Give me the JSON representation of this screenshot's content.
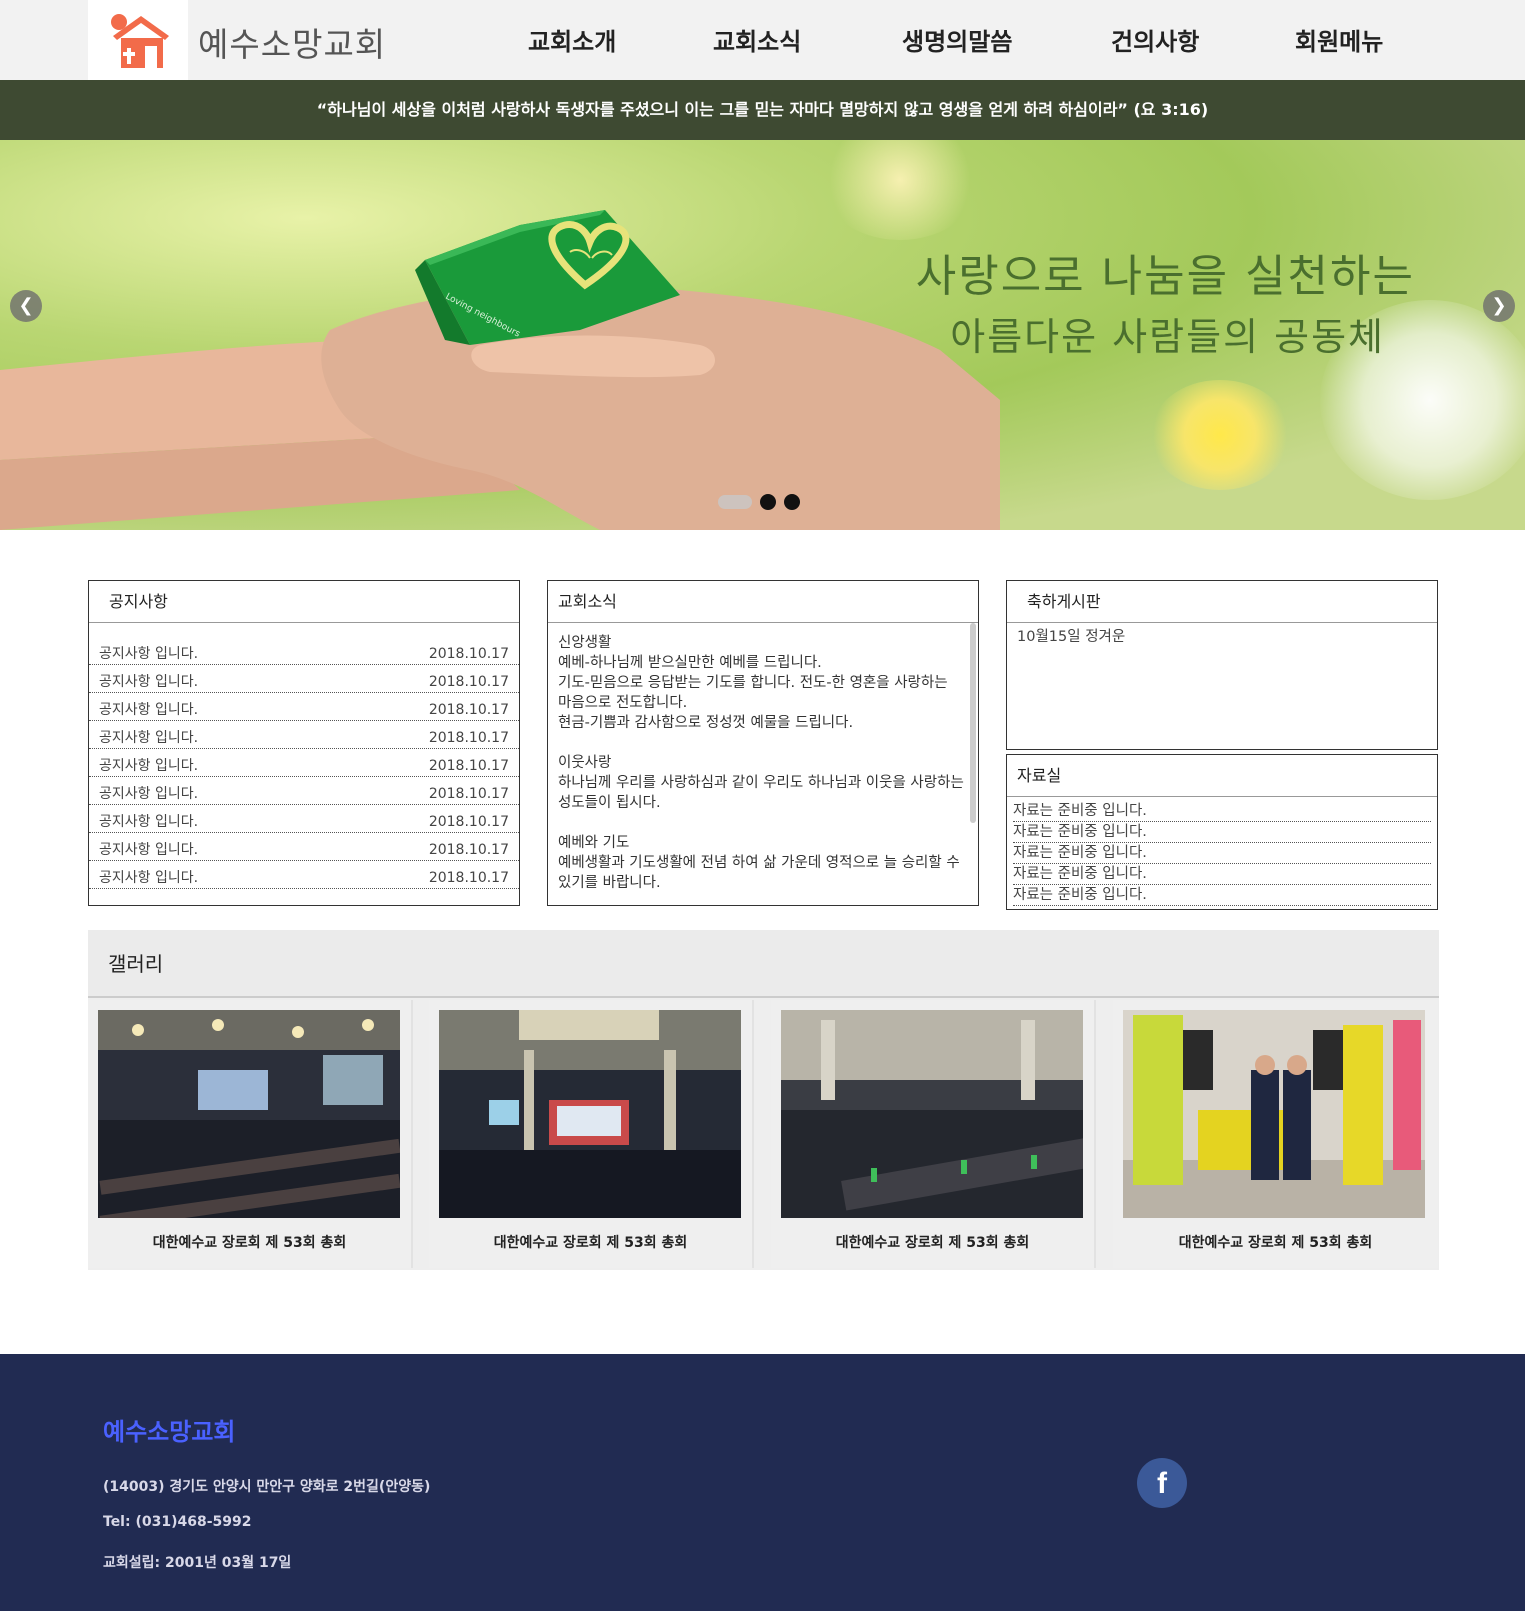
{
  "header": {
    "site_title": "예수소망교회",
    "nav": [
      "교회소개",
      "교회소식",
      "생명의말씀",
      "건의사항",
      "회원메뉴"
    ]
  },
  "verse": "“하나님이 세상을 이처럼 사랑하사 독생자를 주셨으니 이는 그를 믿는 자마다 멸망하지 않고 영생을 얻게 하려 하심이라” (요 3:16)",
  "slider": {
    "line1": "사랑으로 나눔을 실천하는",
    "line2": "아름다운 사람들의 공동체",
    "box_text": "Loving neighbours",
    "prev": "❮",
    "next": "❯",
    "slide_count": 3,
    "active_index": 0
  },
  "notice": {
    "title": "공지사항",
    "rows": [
      {
        "text": "공지사항 입니다.",
        "date": "2018.10.17"
      },
      {
        "text": "공지사항 입니다.",
        "date": "2018.10.17"
      },
      {
        "text": "공지사항 입니다.",
        "date": "2018.10.17"
      },
      {
        "text": "공지사항 입니다.",
        "date": "2018.10.17"
      },
      {
        "text": "공지사항 입니다.",
        "date": "2018.10.17"
      },
      {
        "text": "공지사항 입니다.",
        "date": "2018.10.17"
      },
      {
        "text": "공지사항 입니다.",
        "date": "2018.10.17"
      },
      {
        "text": "공지사항 입니다.",
        "date": "2018.10.17"
      },
      {
        "text": "공지사항 입니다.",
        "date": "2018.10.17"
      }
    ]
  },
  "news": {
    "title": "교회소식",
    "lines": [
      "신앙생활",
      "예베-하나님께 받으실만한 예베를 드립니다.",
      "기도-믿음으로 응답받는 기도를 합니다. 전도-한 영혼을 사랑하는 마음으로 전도합니다.",
      "현금-기쁨과 감사함으로 정성껏 예물을 드립니다.",
      "",
      "이웃사랑",
      "하나님께 우리를 사랑하심과 같이 우리도 하나님과 이웃을 사랑하는 성도들이 됩시다.",
      "",
      "예베와 기도",
      "예베생활과 기도생활에 전념 하여 삶 가운데 영적으로 늘 승리할 수 있기를 바랍니다."
    ]
  },
  "celebration": {
    "title": "축하게시판",
    "entry": "10월15일 정겨운"
  },
  "archive": {
    "title": "자료실",
    "rows": [
      "자료는 준비중 입니다.",
      "자료는 준비중 입니다.",
      "자료는 준비중 입니다.",
      "자료는 준비중 입니다.",
      "자료는 준비중 입니다."
    ]
  },
  "gallery": {
    "title": "갤러리",
    "items": [
      {
        "caption": "대한예수교 장로회 제 53회 총회"
      },
      {
        "caption": "대한예수교 장로회 제 53회 총회"
      },
      {
        "caption": "대한예수교 장로회 제 53회 총회"
      },
      {
        "caption": "대한예수교 장로회 제 53회 총회"
      }
    ]
  },
  "footer": {
    "title": "예수소망교회",
    "address": "(14003) 경기도 안양시 만안구 양화로 2번길(안양동)",
    "tel": "Tel: (031)468-5992",
    "founded": "교회설립: 2001년 03월 17일",
    "facebook": "f"
  },
  "colors": {
    "logo": "#f26b4a",
    "verse_bar": "#3e4a32",
    "footer_bg": "#212b52",
    "footer_title": "#4a61ff",
    "facebook": "#3b5998"
  }
}
